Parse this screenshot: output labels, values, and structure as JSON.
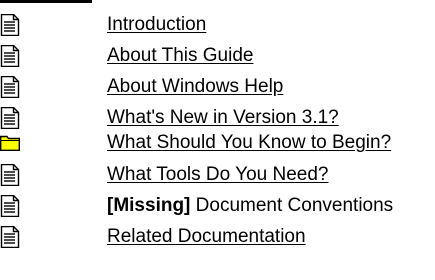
{
  "toc": {
    "items": [
      {
        "icon": "document-icon",
        "label": "Introduction"
      },
      {
        "icon": "document-icon",
        "label": "About This Guide"
      },
      {
        "icon": "document-icon",
        "label": "About Windows Help"
      },
      {
        "icon": "document-icon",
        "label": "What's New in Version 3.1?"
      },
      {
        "icon": "folder-icon",
        "label": "What Should You Know to Begin?"
      },
      {
        "icon": "document-icon",
        "label": "What Tools Do You Need?"
      },
      {
        "icon": "document-icon",
        "tag": "[Missing]",
        "label": "Document Conventions"
      },
      {
        "icon": "document-icon",
        "label": "Related Documentation"
      }
    ]
  },
  "colors": {
    "folder_fill": "#ffff00",
    "text": "#000000"
  }
}
